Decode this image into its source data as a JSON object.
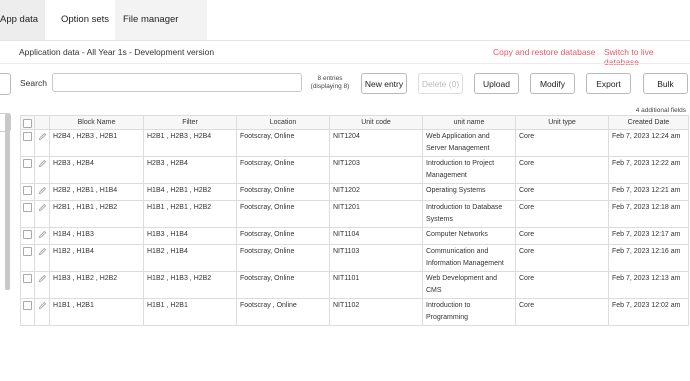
{
  "tabs": [
    {
      "label": "App data",
      "active": true
    },
    {
      "label": "Option sets",
      "active": false
    },
    {
      "label": "File manager",
      "active": false
    }
  ],
  "header": {
    "subtitle": "Application data - All Year 1s - Development version",
    "copy_restore": "Copy and restore database",
    "switch_live": "Switch to live database"
  },
  "toolbar": {
    "search_label": "Search",
    "search_value": "",
    "entries_line1": "8 entries",
    "entries_line2": "(displaying 8)",
    "new_entry": "New entry",
    "delete": "Delete (0)",
    "upload": "Upload",
    "modify": "Modify",
    "export": "Export",
    "bulk": "Bulk"
  },
  "additional_fields": "4 additional fields",
  "table": {
    "columns": [
      "Block Name",
      "Filter",
      "Location",
      "Unit code",
      "unit name",
      "Unit type",
      "Created Date"
    ],
    "rows": [
      {
        "block": "H2B4 , H2B3 , H2B1",
        "filter": "H2B1 , H2B3 , H2B4",
        "location": "Footscray, Online",
        "code": "NIT1204",
        "name": "Web Application and Server Management",
        "type": "Core",
        "date": "Feb 7, 2023 12:24 am"
      },
      {
        "block": "H2B3 , H2B4",
        "filter": "H2B3 , H2B4",
        "location": "Footscray, Online",
        "code": "NIT1203",
        "name": "Introduction to Project Management",
        "type": "Core",
        "date": "Feb 7, 2023 12:22 am"
      },
      {
        "block": "H2B2 , H2B1 , H1B4",
        "filter": "H1B4 , H2B1 , H2B2",
        "location": "Footscray, Online",
        "code": "NIT1202",
        "name": "Operating Systems",
        "type": "Core",
        "date": "Feb 7, 2023 12:21 am"
      },
      {
        "block": "H2B1 , H1B1 , H2B2",
        "filter": "H1B1 , H2B1 , H2B2",
        "location": "Footscray, Online",
        "code": "NIT1201",
        "name": "Introduction to Database Systems",
        "type": "Core",
        "date": "Feb 7, 2023 12:18 am"
      },
      {
        "block": "H1B4 , H1B3",
        "filter": "H1B3 , H1B4",
        "location": "Footscray, Online",
        "code": "NIT1104",
        "name": "Computer Networks",
        "type": "Core",
        "date": "Feb 7, 2023 12:17 am"
      },
      {
        "block": "H1B2 , H1B4",
        "filter": "H1B2 , H1B4",
        "location": "Footscray, Online",
        "code": "NIT1103",
        "name": "Communication and Information Management",
        "type": "Core",
        "date": "Feb 7, 2023 12:16 am"
      },
      {
        "block": "H1B3 , H1B2 , H2B2",
        "filter": "H1B2 , H1B3 , H2B2",
        "location": "Footscray, Online",
        "code": "NIT1101",
        "name": "Web Development and CMS",
        "type": "Core",
        "date": "Feb 7, 2023 12:13 am"
      },
      {
        "block": "H1B1 , H2B1",
        "filter": "H1B1 , H2B1",
        "location": "Footscray , Online",
        "code": "NIT1102",
        "name": "Introduction to Programming",
        "type": "Core",
        "date": "Feb 7, 2023 12:02 am"
      }
    ]
  },
  "colors": {
    "accent_link": "#e8586a",
    "active_tab_bg": "#ededed",
    "header_bg": "#f7f7f7"
  },
  "icons": {
    "row_edit": "pencil-icon",
    "row_select": "checkbox"
  }
}
